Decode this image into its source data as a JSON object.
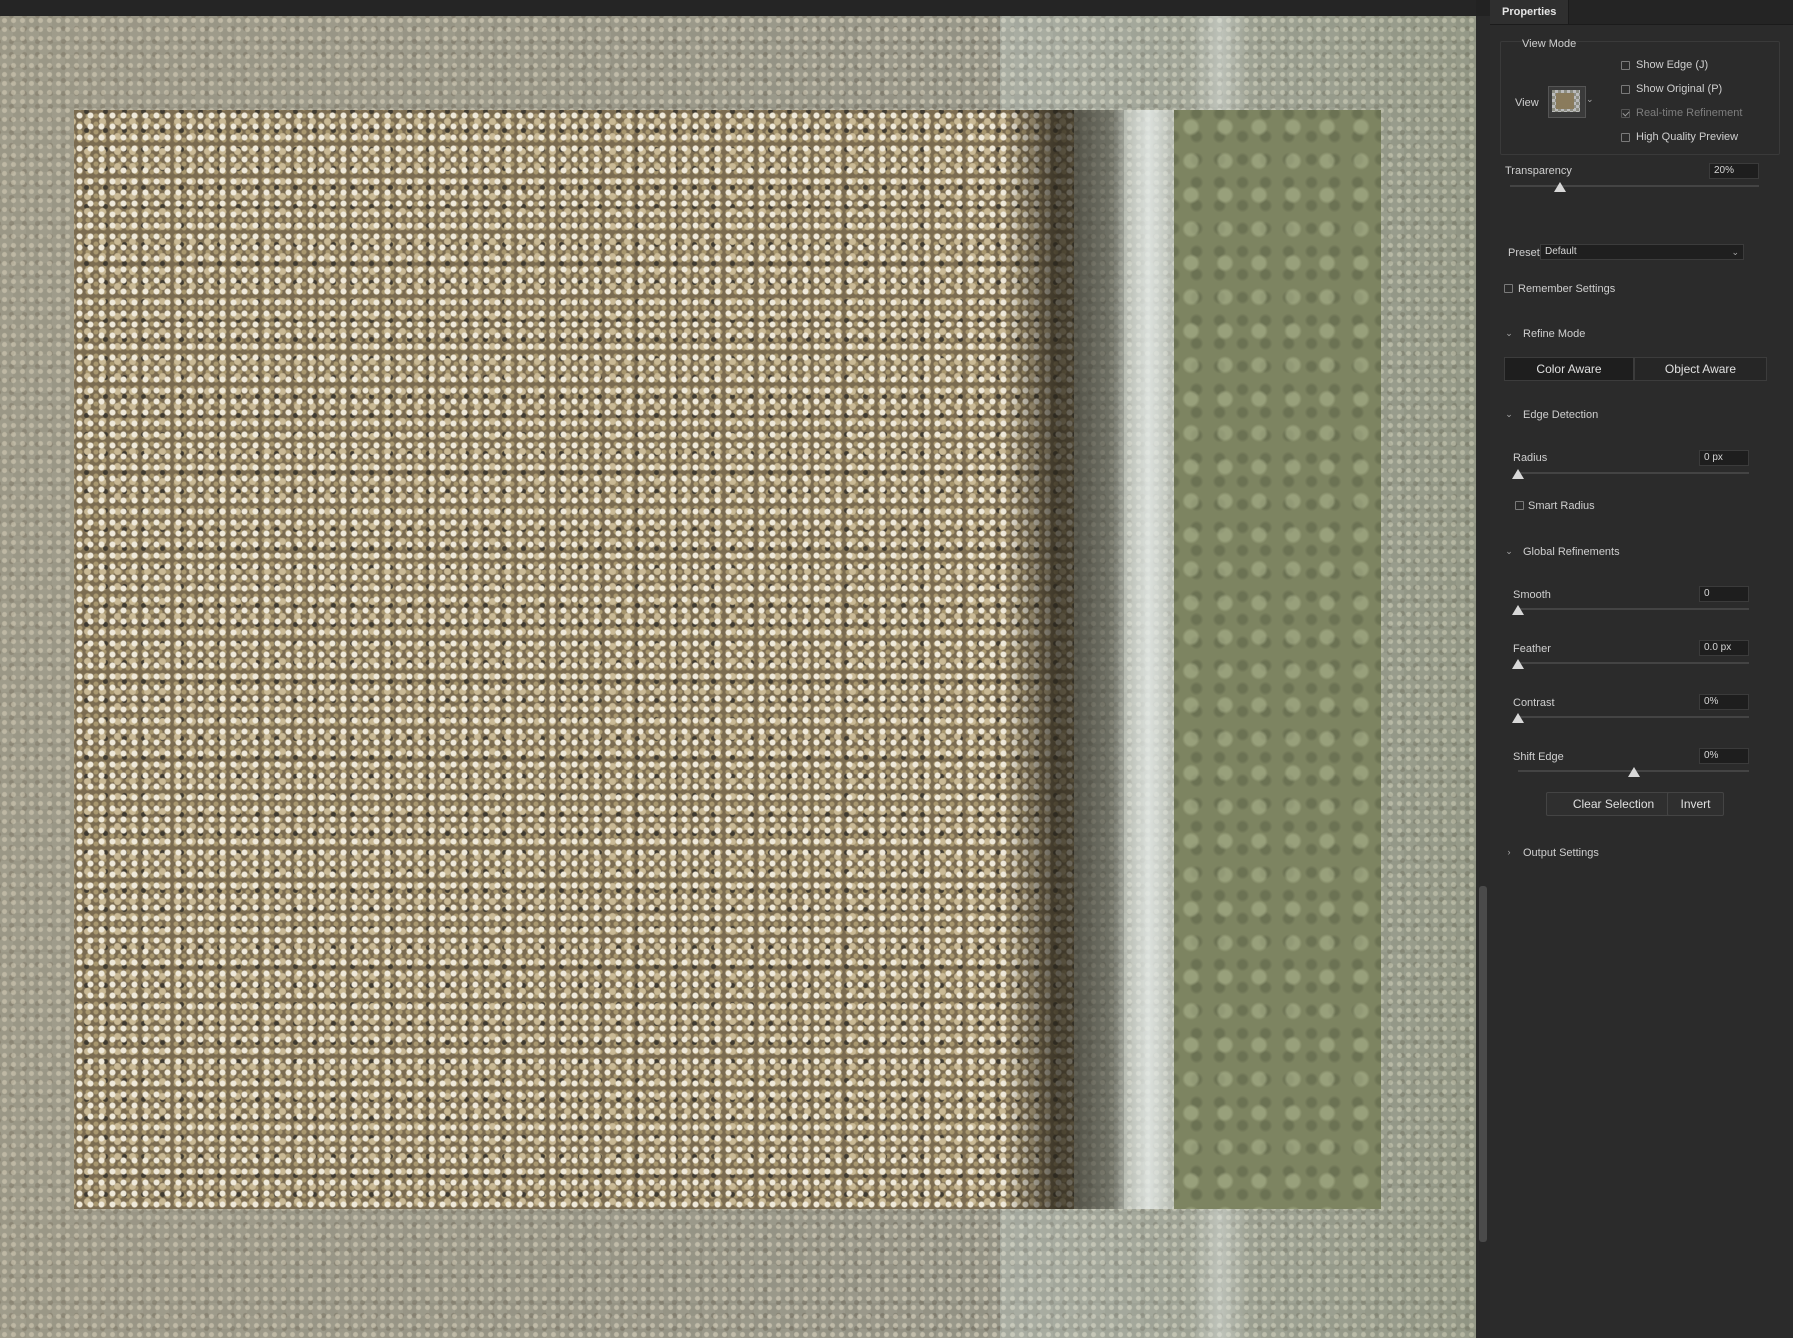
{
  "panel": {
    "tab_label": "Properties",
    "view_mode": {
      "heading": "View Mode",
      "view_label": "View",
      "show_edge": {
        "label": "Show Edge (J)",
        "checked": false
      },
      "show_original": {
        "label": "Show Original (P)",
        "checked": false
      },
      "realtime_refinement": {
        "label": "Real-time Refinement",
        "checked": true,
        "disabled": true
      },
      "high_quality_preview": {
        "label": "High Quality Preview",
        "checked": false
      }
    },
    "transparency": {
      "label": "Transparency",
      "value": "20%",
      "fraction": 0.2
    },
    "preset": {
      "label": "Preset",
      "value": "Default"
    },
    "remember_settings": {
      "label": "Remember Settings",
      "checked": false
    },
    "refine_mode": {
      "heading": "Refine Mode",
      "options": [
        "Color Aware",
        "Object Aware"
      ],
      "selected": "Color Aware"
    },
    "edge_detection": {
      "heading": "Edge Detection",
      "radius": {
        "label": "Radius",
        "value": "0 px",
        "fraction": 0
      },
      "smart_radius": {
        "label": "Smart Radius",
        "checked": false
      }
    },
    "global_refinements": {
      "heading": "Global Refinements",
      "smooth": {
        "label": "Smooth",
        "value": "0",
        "fraction": 0
      },
      "feather": {
        "label": "Feather",
        "value": "0.0 px",
        "fraction": 0
      },
      "contrast": {
        "label": "Contrast",
        "value": "0%",
        "fraction": 0
      },
      "shift_edge": {
        "label": "Shift Edge",
        "value": "0%",
        "fraction": 0.5
      }
    },
    "buttons": {
      "clear_selection": "Clear Selection",
      "invert": "Invert"
    },
    "output_settings": {
      "heading": "Output Settings"
    }
  },
  "colors": {
    "panel_bg": "#2b2b2b",
    "field_bg": "#1e1e1e",
    "text": "#cfcfcf"
  }
}
